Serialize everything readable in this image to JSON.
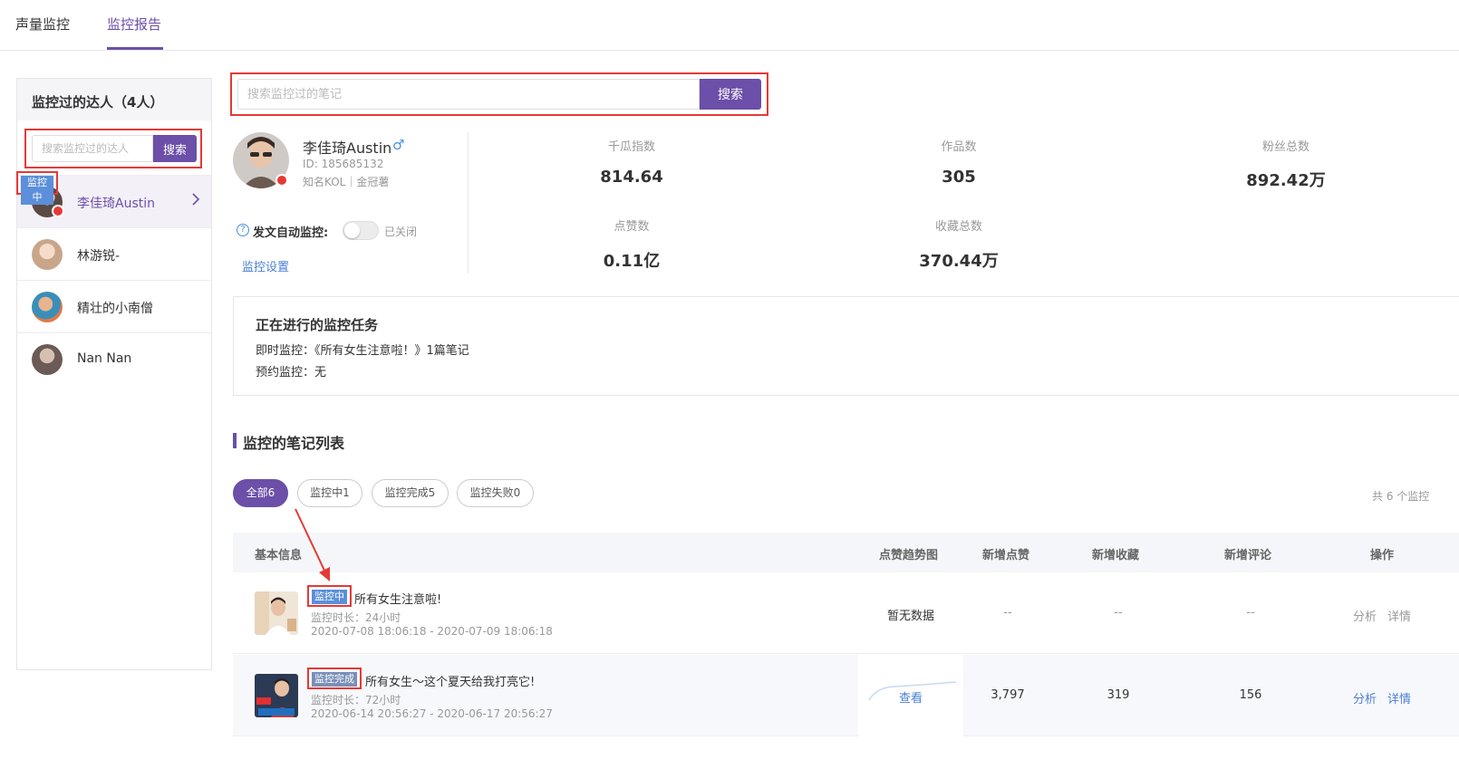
{
  "tabs": [
    {
      "label": "声量监控",
      "active": false
    },
    {
      "label": "监控报告",
      "active": true
    }
  ],
  "colors": {
    "accent": "#6b4fa8",
    "link": "#4a7fd4",
    "highlight": "#e53935",
    "status": "#5b8fd9"
  },
  "left_panel": {
    "title": "监控过的达人（4人）",
    "search_placeholder": "搜索监控过的达人",
    "search_button": "搜索",
    "monitoring_badge": "监控中",
    "items": [
      {
        "name": "李佳琦Austin",
        "active": true
      },
      {
        "name": "林游锐-"
      },
      {
        "name": "精壮的小南僧"
      },
      {
        "name": "Nan Nan"
      }
    ]
  },
  "main_search": {
    "placeholder": "搜索监控过的笔记",
    "button": "搜索"
  },
  "profile": {
    "name": "李佳琦Austin",
    "gender_icon": "♂",
    "id_text": "ID:  185685132",
    "tags": "知名KOL｜金冠薯",
    "auto_monitor_label": "发文自动监控:",
    "toggle_state": "已关闭",
    "settings_link": "监控设置"
  },
  "stats": [
    {
      "label": "千瓜指数",
      "value": "814.64"
    },
    {
      "label": "作品数",
      "value": "305"
    },
    {
      "label": "粉丝总数",
      "value": "892.42万"
    },
    {
      "label": "点赞数",
      "value": "0.11亿"
    },
    {
      "label": "收藏总数",
      "value": "370.44万"
    }
  ],
  "tasks": {
    "title": "正在进行的监控任务",
    "instant": "即时监控：《所有女生注意啦！》1篇笔记",
    "scheduled": "预约监控：无"
  },
  "notes": {
    "title": "监控的笔记列表",
    "filters": [
      {
        "label": "全部6",
        "active": true
      },
      {
        "label": "监控中1"
      },
      {
        "label": "监控完成5"
      },
      {
        "label": "监控失败0"
      }
    ],
    "total": "共 6 个监控",
    "columns": [
      "基本信息",
      "点赞趋势图",
      "新增点赞",
      "新增收藏",
      "新增评论",
      "操作"
    ],
    "rows": [
      {
        "status": "监控中",
        "title": "所有女生注意啦!",
        "duration": "监控时长：24小时",
        "range": "2020-07-08 18:06:18 - 2020-07-09 18:06:18",
        "trend": "暂无数据",
        "likes": "--",
        "collects": "--",
        "comments": "--",
        "op_analyze": "分析",
        "op_detail": "详情"
      },
      {
        "status": "监控完成",
        "title": "所有女生～这个夏天给我打亮它!",
        "duration": "监控时长：72小时",
        "range": "2020-06-14 20:56:27 - 2020-06-17 20:56:27",
        "trend": "查看",
        "likes": "3,797",
        "collects": "319",
        "comments": "156",
        "op_analyze": "分析",
        "op_detail": "详情"
      }
    ]
  }
}
